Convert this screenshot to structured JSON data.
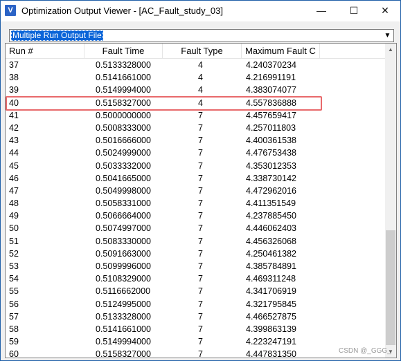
{
  "window": {
    "title": "Optimization Output Viewer - [AC_Fault_study_03]",
    "icon": "viewer-app-icon",
    "controls": {
      "minimize": "—",
      "maximize": "☐",
      "close": "✕"
    }
  },
  "selector": {
    "value": "Multiple Run Output File",
    "arrow": "▼"
  },
  "table": {
    "columns": [
      "Run #",
      "Fault Time",
      "Fault Type",
      "Maximum Fault C"
    ],
    "highlighted_run": "40",
    "rows": [
      {
        "run": "37",
        "fault_time": "0.5133328000",
        "fault_type": "4",
        "max_fault": "4.240370234"
      },
      {
        "run": "38",
        "fault_time": "0.5141661000",
        "fault_type": "4",
        "max_fault": "4.216991191"
      },
      {
        "run": "39",
        "fault_time": "0.5149994000",
        "fault_type": "4",
        "max_fault": "4.383074077"
      },
      {
        "run": "40",
        "fault_time": "0.5158327000",
        "fault_type": "4",
        "max_fault": "4.557836888"
      },
      {
        "run": "41",
        "fault_time": "0.5000000000",
        "fault_type": "7",
        "max_fault": "4.457659417"
      },
      {
        "run": "42",
        "fault_time": "0.5008333000",
        "fault_type": "7",
        "max_fault": "4.257011803"
      },
      {
        "run": "43",
        "fault_time": "0.5016666000",
        "fault_type": "7",
        "max_fault": "4.400361538"
      },
      {
        "run": "44",
        "fault_time": "0.5024999000",
        "fault_type": "7",
        "max_fault": "4.476753438"
      },
      {
        "run": "45",
        "fault_time": "0.5033332000",
        "fault_type": "7",
        "max_fault": "4.353012353"
      },
      {
        "run": "46",
        "fault_time": "0.5041665000",
        "fault_type": "7",
        "max_fault": "4.338730142"
      },
      {
        "run": "47",
        "fault_time": "0.5049998000",
        "fault_type": "7",
        "max_fault": "4.472962016"
      },
      {
        "run": "48",
        "fault_time": "0.5058331000",
        "fault_type": "7",
        "max_fault": "4.411351549"
      },
      {
        "run": "49",
        "fault_time": "0.5066664000",
        "fault_type": "7",
        "max_fault": "4.237885450"
      },
      {
        "run": "50",
        "fault_time": "0.5074997000",
        "fault_type": "7",
        "max_fault": "4.446062403"
      },
      {
        "run": "51",
        "fault_time": "0.5083330000",
        "fault_type": "7",
        "max_fault": "4.456326068"
      },
      {
        "run": "52",
        "fault_time": "0.5091663000",
        "fault_type": "7",
        "max_fault": "4.250461382"
      },
      {
        "run": "53",
        "fault_time": "0.5099996000",
        "fault_type": "7",
        "max_fault": "4.385784891"
      },
      {
        "run": "54",
        "fault_time": "0.5108329000",
        "fault_type": "7",
        "max_fault": "4.469311248"
      },
      {
        "run": "55",
        "fault_time": "0.5116662000",
        "fault_type": "7",
        "max_fault": "4.341706919"
      },
      {
        "run": "56",
        "fault_time": "0.5124995000",
        "fault_type": "7",
        "max_fault": "4.321795845"
      },
      {
        "run": "57",
        "fault_time": "0.5133328000",
        "fault_type": "7",
        "max_fault": "4.466527875"
      },
      {
        "run": "58",
        "fault_time": "0.5141661000",
        "fault_type": "7",
        "max_fault": "4.399863139"
      },
      {
        "run": "59",
        "fault_time": "0.5149994000",
        "fault_type": "7",
        "max_fault": "4.223247191"
      },
      {
        "run": "60",
        "fault_time": "0.5158327000",
        "fault_type": "7",
        "max_fault": "4.447831350"
      }
    ]
  },
  "scrollbar": {
    "up": "▲",
    "down": "▼"
  },
  "watermark": "CSDN @_GGG_",
  "colors": {
    "selection": "#0a64d8",
    "highlight_border": "#e8696b",
    "app_icon": "#2b63c6"
  }
}
